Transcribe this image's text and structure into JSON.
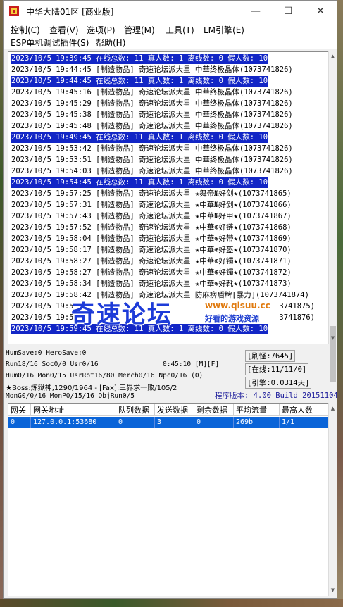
{
  "window": {
    "title": "中华大陆01区 [商业版]",
    "controls": {
      "minimize": "—",
      "maximize": "☐",
      "close": "✕"
    }
  },
  "menu": {
    "row1": [
      "控制(C)",
      "查看(V)",
      "选项(P)",
      "管理(M)",
      "工具(T)",
      "LM引擎(E)"
    ],
    "row2": [
      "ESP单机调试插件(S)",
      "帮助(H)"
    ]
  },
  "log": {
    "lines": [
      {
        "text": "2023/10/5 19:39:45 在线总数: 11 真人数: 1 离线数: 0 假人数: 10",
        "highlight": true
      },
      {
        "text": "2023/10/5 19:44:45 [制造物品] 奇速论坛派大星 中華终极晶体(1073741826)",
        "highlight": false
      },
      {
        "text": "2023/10/5 19:44:45 在线总数: 11 真人数: 1 离线数: 0 假人数: 10",
        "highlight": true
      },
      {
        "text": "2023/10/5 19:45:16 [制造物品] 奇速论坛派大星 中華终极晶体(1073741826)",
        "highlight": false
      },
      {
        "text": "2023/10/5 19:45:29 [制造物品] 奇速论坛派大星 中華终极晶体(1073741826)",
        "highlight": false
      },
      {
        "text": "2023/10/5 19:45:38 [制造物品] 奇速论坛派大星 中華终极晶体(1073741826)",
        "highlight": false
      },
      {
        "text": "2023/10/5 19:45:48 [制造物品] 奇速论坛派大星 中華终极晶体(1073741826)",
        "highlight": false
      },
      {
        "text": "2023/10/5 19:49:45 在线总数: 11 真人数: 1 离线数: 0 假人数: 10",
        "highlight": true
      },
      {
        "text": "2023/10/5 19:53:42 [制造物品] 奇速论坛派大星 中華终极晶体(1073741826)",
        "highlight": false
      },
      {
        "text": "2023/10/5 19:53:51 [制造物品] 奇速论坛派大星 中華终极晶体(1073741826)",
        "highlight": false
      },
      {
        "text": "2023/10/5 19:54:03 [制造物品] 奇速论坛派大星 中華终极晶体(1073741826)",
        "highlight": false
      },
      {
        "text": "2023/10/5 19:54:45 在线总数: 11 真人数: 1 离线数: 0 假人数: 10",
        "highlight": true
      },
      {
        "text": "2023/10/5 19:57:25 [制造物品] 奇速论坛派大星 ★舞帝№好剑★(1073741865)",
        "highlight": false
      },
      {
        "text": "2023/10/5 19:57:31 [制造物品] 奇速论坛派大星 ★中華№好剑★(1073741866)",
        "highlight": false
      },
      {
        "text": "2023/10/5 19:57:43 [制造物品] 奇速论坛派大星 ★中華№好甲★(1073741867)",
        "highlight": false
      },
      {
        "text": "2023/10/5 19:57:52 [制造物品] 奇速论坛派大星 ★中華⊕好链★(1073741868)",
        "highlight": false
      },
      {
        "text": "2023/10/5 19:58:04 [制造物品] 奇速论坛派大星 ★中華⊕好带★(1073741869)",
        "highlight": false
      },
      {
        "text": "2023/10/5 19:58:17 [制造物品] 奇速论坛派大星 ★中華⊕好盔★(1073741870)",
        "highlight": false
      },
      {
        "text": "2023/10/5 19:58:27 [制造物品] 奇速论坛派大星 ★中華⊕好镯★(1073741871)",
        "highlight": false
      },
      {
        "text": "2023/10/5 19:58:27 [制造物品] 奇速论坛派大星 ★中華⊕好镯★(1073741872)",
        "highlight": false
      },
      {
        "text": "2023/10/5 19:58:34 [制造物品] 奇速论坛派大星 ★中華⊕好靴★(1073741873)",
        "highlight": false
      },
      {
        "text": "2023/10/5 19:58:42 [制造物品] 奇速论坛派大星 防麻痹盾牌[暴力](1073741874)",
        "highlight": false
      },
      {
        "text": "2023/10/5 19:5",
        "highlight": false,
        "tail": "3741875)"
      },
      {
        "text": "2023/10/5 19:5",
        "highlight": false,
        "tail": "3741876)"
      },
      {
        "text": "2023/10/5 19:59:45 在线总数: 11 真人数: 1 离线数: 0 假人数: 10",
        "highlight": true
      }
    ]
  },
  "watermark": {
    "main": "奇速论坛",
    "url": "www.qisuu.cc",
    "sub": "好看的游戏资源"
  },
  "status": {
    "line1": "HumSave:0 HeroSave:0",
    "line2_left": "Run18/16 Soc0/0 Usr0/16",
    "line2_time": "0:45:10 [M][F]",
    "line3": "Hum0/16 Mon0/15 UsrRot16/80 Merch0/16 Npc0/16 (0)",
    "line4": "★Boss:炼狱神,1290/1964 - [Fax]:三界求一败/105/2",
    "line5": "MonG0/0/16 MonP0/15/16 ObjRun0/5",
    "refresh_monster": "[刷怪:7645]",
    "online": "[在线:11/11/0]",
    "engine": "[引擎:0.0314天]",
    "version": "程序版本: 4.00 Build 20151104"
  },
  "gateway_table": {
    "headers": [
      "网关",
      "网关地址",
      "队列数据",
      "发送数据",
      "剩余数据",
      "平均流量",
      "最高人数"
    ],
    "rows": [
      [
        "0",
        "127.0.0.1:53680",
        "0",
        "3",
        "0",
        "269b",
        "1/1"
      ]
    ]
  },
  "colors": {
    "highlight_bg": "#1226c6",
    "selected_row": "#0a64d8",
    "version_text": "#1a1a9a",
    "watermark": "#1d3bd8"
  }
}
